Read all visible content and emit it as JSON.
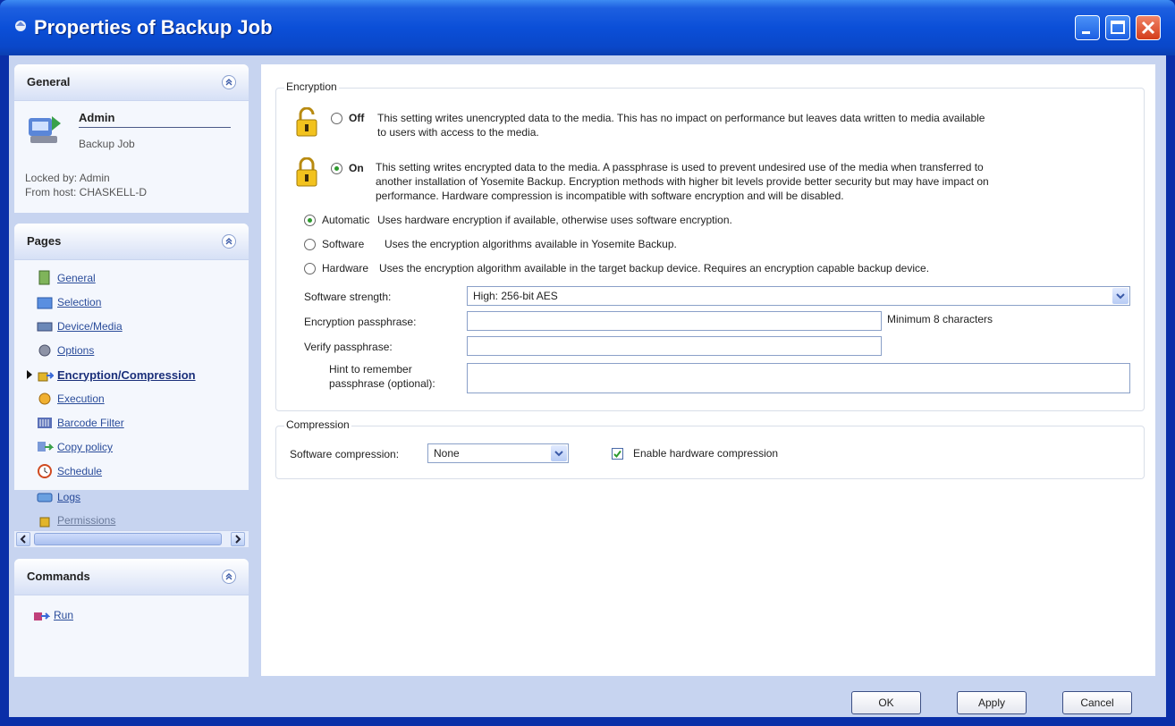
{
  "window": {
    "title": "Properties of Backup Job"
  },
  "general": {
    "header": "General",
    "job_name": "Admin",
    "job_type": "Backup Job",
    "locked_by": "Locked by: Admin",
    "from_host": "From host: CHASKELL-D"
  },
  "pages": {
    "header": "Pages",
    "items": [
      {
        "label": "General",
        "icon": "document-icon"
      },
      {
        "label": "Selection",
        "icon": "folder-icon"
      },
      {
        "label": "Device/Media",
        "icon": "device-icon"
      },
      {
        "label": "Options",
        "icon": "options-icon"
      },
      {
        "label": "Encryption/Compression",
        "icon": "encryption-icon",
        "active": true
      },
      {
        "label": "Execution",
        "icon": "execution-icon"
      },
      {
        "label": "Barcode Filter",
        "icon": "barcode-icon"
      },
      {
        "label": "Copy policy",
        "icon": "copy-icon"
      },
      {
        "label": "Schedule",
        "icon": "schedule-icon"
      },
      {
        "label": "Logs",
        "icon": "logs-icon"
      },
      {
        "label": "Permissions",
        "icon": "permissions-icon"
      }
    ]
  },
  "commands": {
    "header": "Commands",
    "run_label": "Run"
  },
  "encryption": {
    "group_label": "Encryption",
    "off_label": "Off",
    "off_desc_1": "This setting writes unencrypted data to the media.  This has no impact on performance but leaves data written to media available",
    "off_desc_2": "to users with access to the media.",
    "on_label": "On",
    "on_desc_1": "This setting writes encrypted data to the media.  A passphrase is used to prevent undesired use of the media when transferred to",
    "on_desc_2": "another installation of Yosemite Backup.  Encryption methods with higher bit levels provide better security but may have impact on",
    "on_desc_3": "performance.  Hardware compression is incompatible with software encryption and will be disabled.",
    "automatic_label": "Automatic",
    "automatic_desc": "Uses hardware encryption if available, otherwise uses software encryption.",
    "software_label": "Software",
    "software_desc": "Uses the encryption algorithms available in Yosemite Backup.",
    "hardware_label": "Hardware",
    "hardware_desc": "Uses the encryption algorithm available in the target backup device.  Requires an encryption capable backup device.",
    "strength_label": "Software strength:",
    "strength_value": "High: 256-bit AES",
    "passphrase_label": "Encryption passphrase:",
    "passphrase_value": "",
    "passphrase_hint": "Minimum 8 characters",
    "verify_label": "Verify passphrase:",
    "verify_value": "",
    "hint_label_1": "Hint to remember",
    "hint_label_2": "passphrase (optional):",
    "hint_value": ""
  },
  "compression": {
    "group_label": "Compression",
    "software_label": "Software compression:",
    "software_value": "None",
    "hardware_label": "Enable hardware compression"
  },
  "buttons": {
    "ok": "OK",
    "apply": "Apply",
    "cancel": "Cancel"
  },
  "colors": {
    "titlebar": "#0b4fd8",
    "panel_bg": "#c7d4f0",
    "link": "#2a4c9a"
  }
}
